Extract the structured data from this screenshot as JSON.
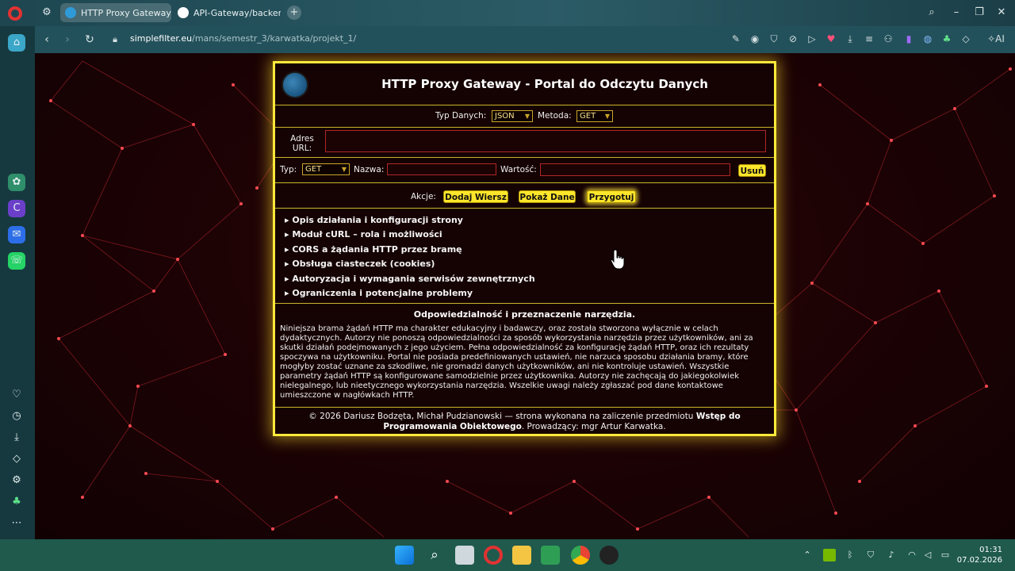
{
  "browser": {
    "tabs": [
      {
        "label": "HTTP Proxy Gateway",
        "active": true
      },
      {
        "label": "API-Gateway/backend at",
        "active": false
      }
    ],
    "url_host": "simplefilter.eu",
    "url_path": "/mans/semestr_3/karwatka/projekt_1/"
  },
  "portal": {
    "title": "HTTP Proxy Gateway - Portal do Odczytu Danych",
    "type_label": "Typ Danych:",
    "type_value": "JSON",
    "method_label": "Metoda:",
    "method_value": "GET",
    "url_label_line1": "Adres",
    "url_label_line2": "URL:",
    "row": {
      "type_label": "Typ:",
      "type_value": "GET",
      "name_label": "Nazwa:",
      "value_label": "Wartość:",
      "delete_label": "Usuń"
    },
    "actions_label": "Akcje:",
    "actions": [
      "Dodaj Wiersz",
      "Pokaż Dane",
      "Przygotuj"
    ],
    "sections": [
      "▸ Opis działania i konfiguracji strony",
      "▸ Moduł cURL – rola i możliwości",
      "▸ CORS a żądania HTTP przez bramę",
      "▸ Obsługa ciasteczek (cookies)",
      "▸ Autoryzacja i wymagania serwisów zewnętrznych",
      "▸ Ograniczenia i potencjalne problemy"
    ],
    "notice_title": "Odpowiedzialność i przeznaczenie narzędzia.",
    "notice_text": "Niniejsza brama żądań HTTP ma charakter edukacyjny i badawczy, oraz została stworzona wyłącznie w celach dydaktycznych. Autorzy nie ponoszą odpowiedzialności za sposób wykorzystania narzędzia przez użytkowników, ani za skutki działań podejmowanych z jego użyciem. Pełna odpowiedzialność za konfigurację żądań HTTP, oraz ich rezultaty spoczywa na użytkowniku. Portal nie posiada predefiniowanych ustawień, nie narzuca sposobu działania bramy, które mogłyby zostać uznane za szkodliwe, nie gromadzi danych użytkowników, ani nie kontroluje ustawień. Wszystkie parametry żądań HTTP są konfigurowane samodzielnie przez użytkownika. Autorzy nie zachęcają do jakiegokolwiek nielegalnego, lub nieetycznego wykorzystania narzędzia. Wszelkie uwagi należy zgłaszać pod dane kontaktowe umieszczone w nagłówkach HTTP.",
    "footer_prefix": "© 2026 Dariusz Bodzęta, Michał Pudzianowski — strona wykonana na zaliczenie przedmiotu ",
    "footer_course": "Wstęp do Programowania Obiektowego",
    "footer_suffix": ". Prowadzący: mgr Artur Karwatka."
  },
  "taskbar": {
    "time": "01:31",
    "date": "07.02.2026"
  },
  "colors": {
    "panel_border": "#ffe93a",
    "button_yellow": "#ffe62b",
    "tabbar": "#2b5b66",
    "taskbar": "#1f5a4d"
  }
}
